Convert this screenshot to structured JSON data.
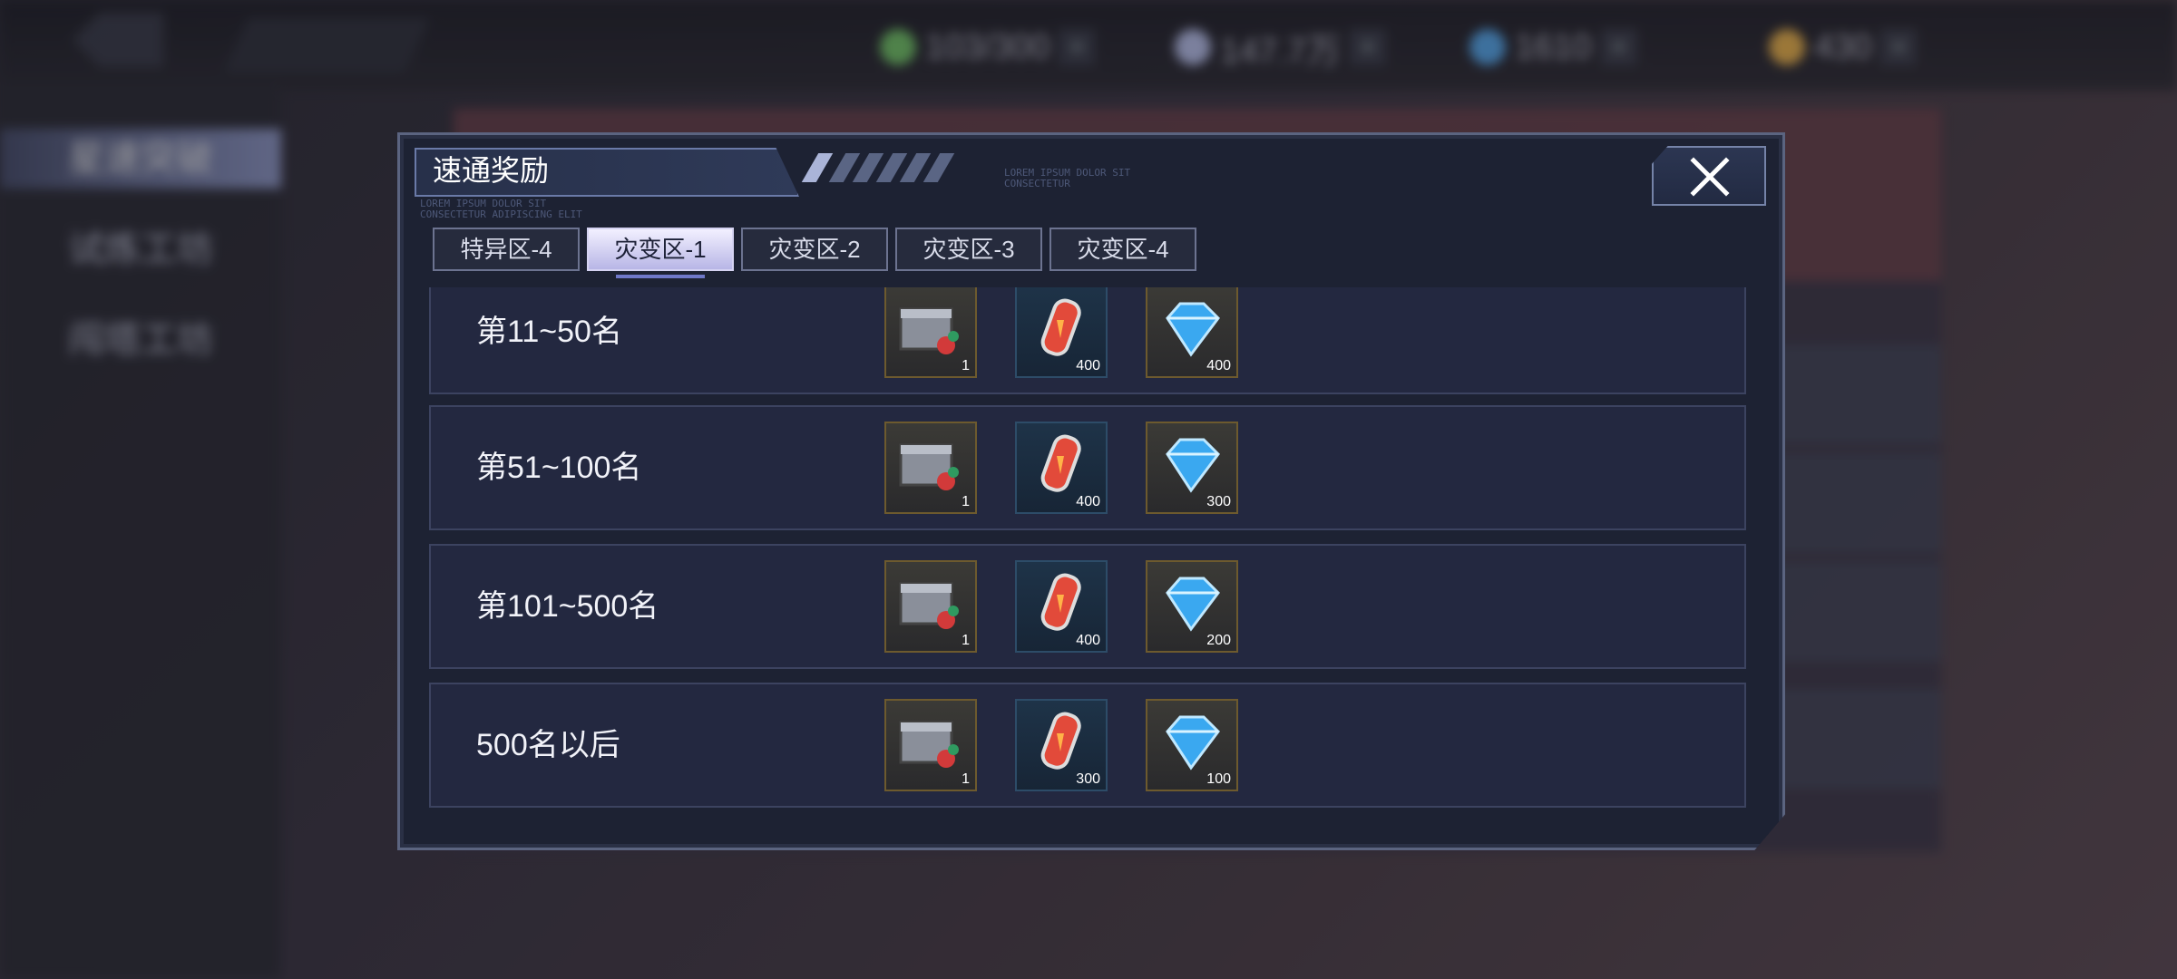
{
  "topbar": {
    "resources": [
      {
        "icon": "energy-icon",
        "value": "103/300",
        "color": "#79d66a"
      },
      {
        "icon": "silver-gem-icon",
        "value": "147.7万",
        "color": "#c8d2ff"
      },
      {
        "icon": "blue-crystal-icon",
        "value": "1610",
        "color": "#58b5ff"
      },
      {
        "icon": "gold-ticket-icon",
        "value": "430",
        "color": "#ffc14a"
      }
    ]
  },
  "sidebar": {
    "items": [
      {
        "label": "星速突破"
      },
      {
        "label": "试炼工坊"
      },
      {
        "label": "闯塔工坊"
      }
    ]
  },
  "dialog": {
    "title": "速通奖励",
    "deco_text_1": "LOREM IPSUM DOLOR SIT CONSECTETUR",
    "deco_text_2": "LOREM IPSUM DOLOR SIT\nCONSECTETUR ADIPISCING ELIT",
    "tabs": [
      {
        "label": "特异区-4"
      },
      {
        "label": "灾变区-1"
      },
      {
        "label": "灾变区-2"
      },
      {
        "label": "灾变区-3"
      },
      {
        "label": "灾变区-4"
      }
    ],
    "active_tab_index": 1,
    "rows": [
      {
        "rank": "第11~50名",
        "rewards": [
          {
            "icon": "tech-chest-icon",
            "count": "1"
          },
          {
            "icon": "energy-capsule-icon",
            "count": "400"
          },
          {
            "icon": "diamond-icon",
            "count": "400"
          }
        ]
      },
      {
        "rank": "第51~100名",
        "rewards": [
          {
            "icon": "tech-chest-icon",
            "count": "1"
          },
          {
            "icon": "energy-capsule-icon",
            "count": "400"
          },
          {
            "icon": "diamond-icon",
            "count": "300"
          }
        ]
      },
      {
        "rank": "第101~500名",
        "rewards": [
          {
            "icon": "tech-chest-icon",
            "count": "1"
          },
          {
            "icon": "energy-capsule-icon",
            "count": "400"
          },
          {
            "icon": "diamond-icon",
            "count": "200"
          }
        ]
      },
      {
        "rank": "500名以后",
        "rewards": [
          {
            "icon": "tech-chest-icon",
            "count": "1"
          },
          {
            "icon": "energy-capsule-icon",
            "count": "300"
          },
          {
            "icon": "diamond-icon",
            "count": "100"
          }
        ]
      }
    ]
  }
}
